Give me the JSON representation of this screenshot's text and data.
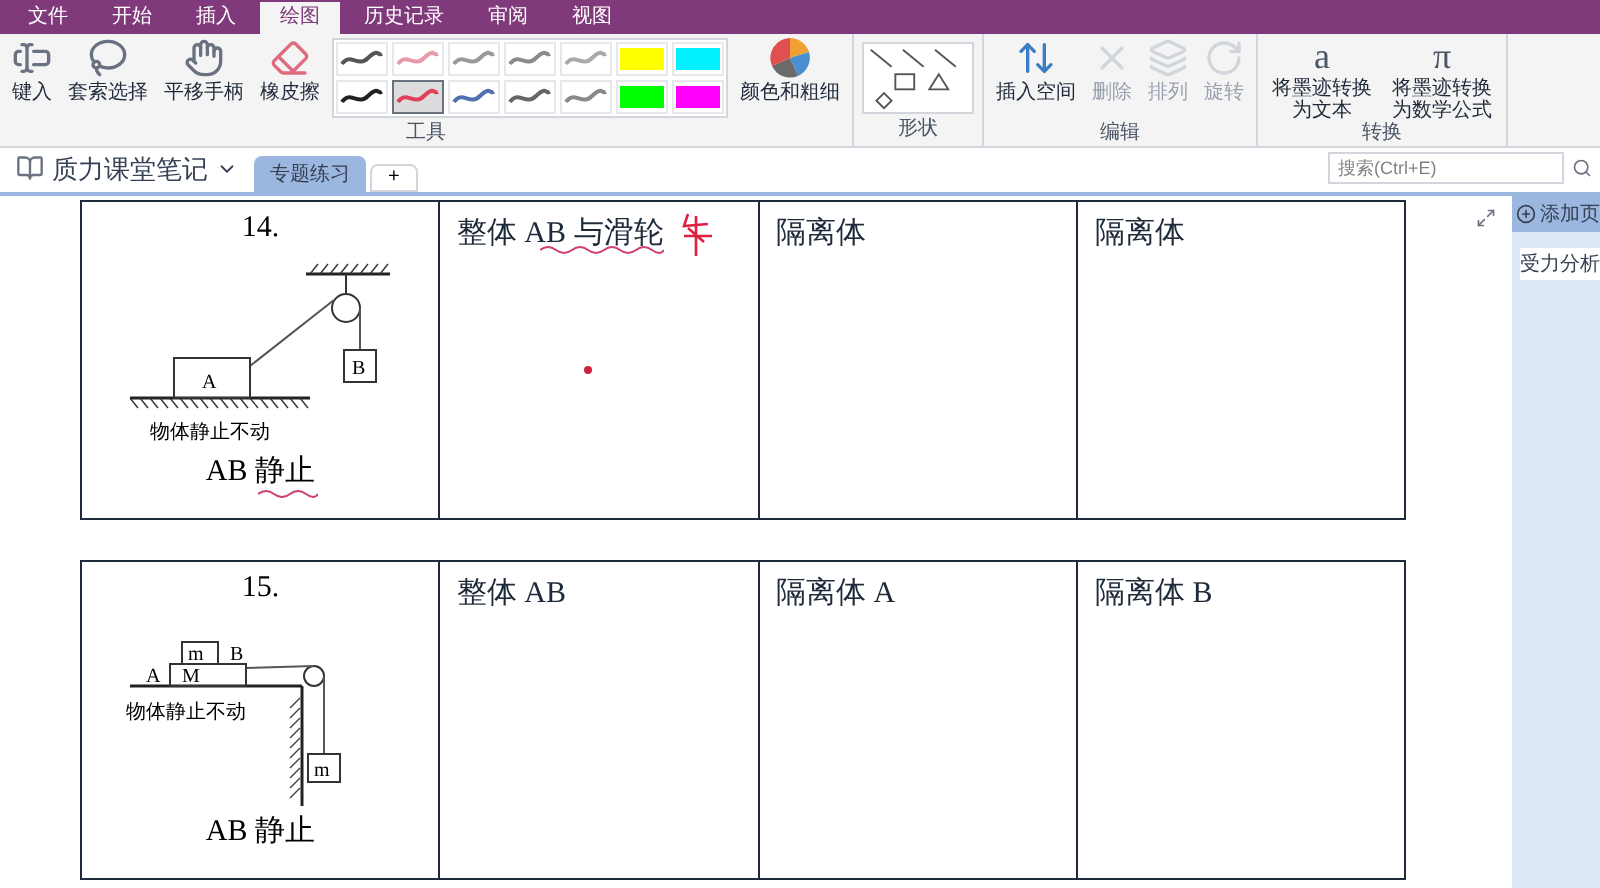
{
  "menu_tabs": [
    {
      "label": "文件",
      "selected": false
    },
    {
      "label": "开始",
      "selected": false
    },
    {
      "label": "插入",
      "selected": false
    },
    {
      "label": "绘图",
      "selected": true
    },
    {
      "label": "历史记录",
      "selected": false
    },
    {
      "label": "审阅",
      "selected": false
    },
    {
      "label": "视图",
      "selected": false
    }
  ],
  "ribbon": {
    "groups": [
      {
        "label": "工具",
        "buttons": [
          {
            "kind": "type",
            "label": "键入"
          },
          {
            "kind": "lasso",
            "label": "套索选择"
          },
          {
            "kind": "hand",
            "label": "平移手柄"
          },
          {
            "kind": "eraser",
            "label": "橡皮擦"
          }
        ],
        "pens": [
          {
            "kind": "pen",
            "color": "#555555",
            "selected": false
          },
          {
            "kind": "pen",
            "color": "#e89aa8",
            "selected": false
          },
          {
            "kind": "pen",
            "color": "#9a9a9a",
            "selected": false
          },
          {
            "kind": "pen",
            "color": "#8a8a8a",
            "selected": false
          },
          {
            "kind": "pen",
            "color": "#aaaaaa",
            "selected": false
          },
          {
            "kind": "highlighter",
            "color": "#ffff00",
            "selected": false
          },
          {
            "kind": "highlighter",
            "color": "#00f0ff",
            "selected": false
          },
          {
            "kind": "pen",
            "color": "#222222",
            "selected": false
          },
          {
            "kind": "pen",
            "color": "#e0405a",
            "selected": true
          },
          {
            "kind": "pen",
            "color": "#5070b0",
            "selected": false
          },
          {
            "kind": "pen",
            "color": "#666666",
            "selected": false
          },
          {
            "kind": "pen",
            "color": "#888888",
            "selected": false
          },
          {
            "kind": "highlighter",
            "color": "#00ff00",
            "selected": false
          },
          {
            "kind": "highlighter",
            "color": "#ff00ff",
            "selected": false
          }
        ],
        "color_button": "颜色和粗细"
      },
      {
        "label": "形状"
      },
      {
        "label": "编辑",
        "buttons": [
          {
            "kind": "space",
            "label": "插入空间",
            "disabled": false
          },
          {
            "kind": "delete",
            "label": "删除",
            "disabled": true
          },
          {
            "kind": "arrange",
            "label": "排列",
            "disabled": true
          },
          {
            "kind": "rotate",
            "label": "旋转",
            "disabled": true
          }
        ]
      },
      {
        "label": "转换",
        "buttons": [
          {
            "kind": "text",
            "glyph": "a",
            "label": "将墨迹转换为文本"
          },
          {
            "kind": "math",
            "glyph": "π",
            "label": "将墨迹转换为数学公式"
          }
        ]
      }
    ]
  },
  "notebook": {
    "title": "质力课堂笔记",
    "sections": [
      {
        "label": "专题练习",
        "selected": true
      }
    ],
    "add_tab": "+",
    "search": {
      "placeholder": "搜索(Ctrl+E)"
    }
  },
  "pages_pane": {
    "add_page": "添加页",
    "pages": [
      {
        "label": "受力分析",
        "selected": true
      }
    ]
  },
  "problems": [
    {
      "kind": "hanging",
      "number": "14.",
      "labels": [
        "A",
        "B"
      ],
      "note": "物体静止不动",
      "caption": "AB 静止",
      "columns": [
        "整体 AB 与滑轮",
        "隔离体",
        "隔离体"
      ]
    },
    {
      "kind": "table_edge",
      "number": "15.",
      "labels": [
        "m",
        "B",
        "A",
        "M",
        "m"
      ],
      "note": "物体静止不动",
      "caption": "AB 静止",
      "columns": [
        "整体 AB",
        "隔离体 A",
        "隔离体 B"
      ]
    }
  ]
}
